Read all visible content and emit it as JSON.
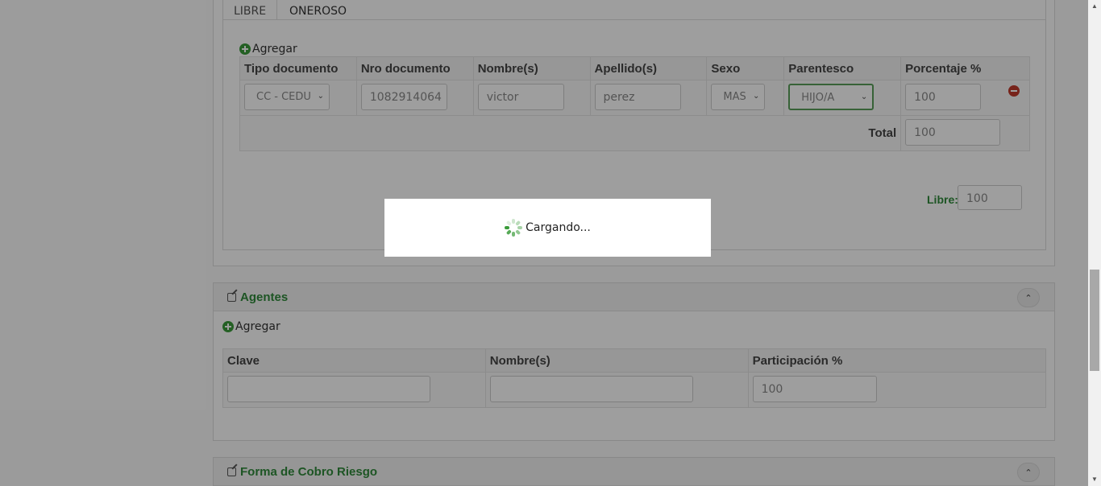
{
  "beneficiarios": {
    "tabs": [
      {
        "label": "LIBRE"
      },
      {
        "label": "ONEROSO"
      }
    ],
    "add_label": "Agregar",
    "columns": [
      "Tipo documento",
      "Nro documento",
      "Nombre(s)",
      "Apellido(s)",
      "Sexo",
      "Parentesco",
      "Porcentaje %"
    ],
    "row": {
      "tipo_documento": "CC - CEDU",
      "nro_documento": "1082914064",
      "nombre": "victor",
      "apellido": "perez",
      "sexo": "MAS",
      "parentesco": "HIJO/A",
      "porcentaje": "100"
    },
    "total_label": "Total",
    "total_value": "100",
    "libre_label": "Libre:",
    "libre_value": "100"
  },
  "agentes": {
    "title": "Agentes",
    "add_label": "Agregar",
    "columns": [
      "Clave",
      "Nombre(s)",
      "Participación %"
    ],
    "row": {
      "clave": "",
      "nombre": "",
      "participacion": "100"
    }
  },
  "forma_cobro": {
    "title": "Forma de Cobro Riesgo"
  },
  "loading": {
    "text": "Cargando..."
  },
  "colors": {
    "accent_green": "#2f8a3a",
    "remove_red": "#c0392b"
  }
}
